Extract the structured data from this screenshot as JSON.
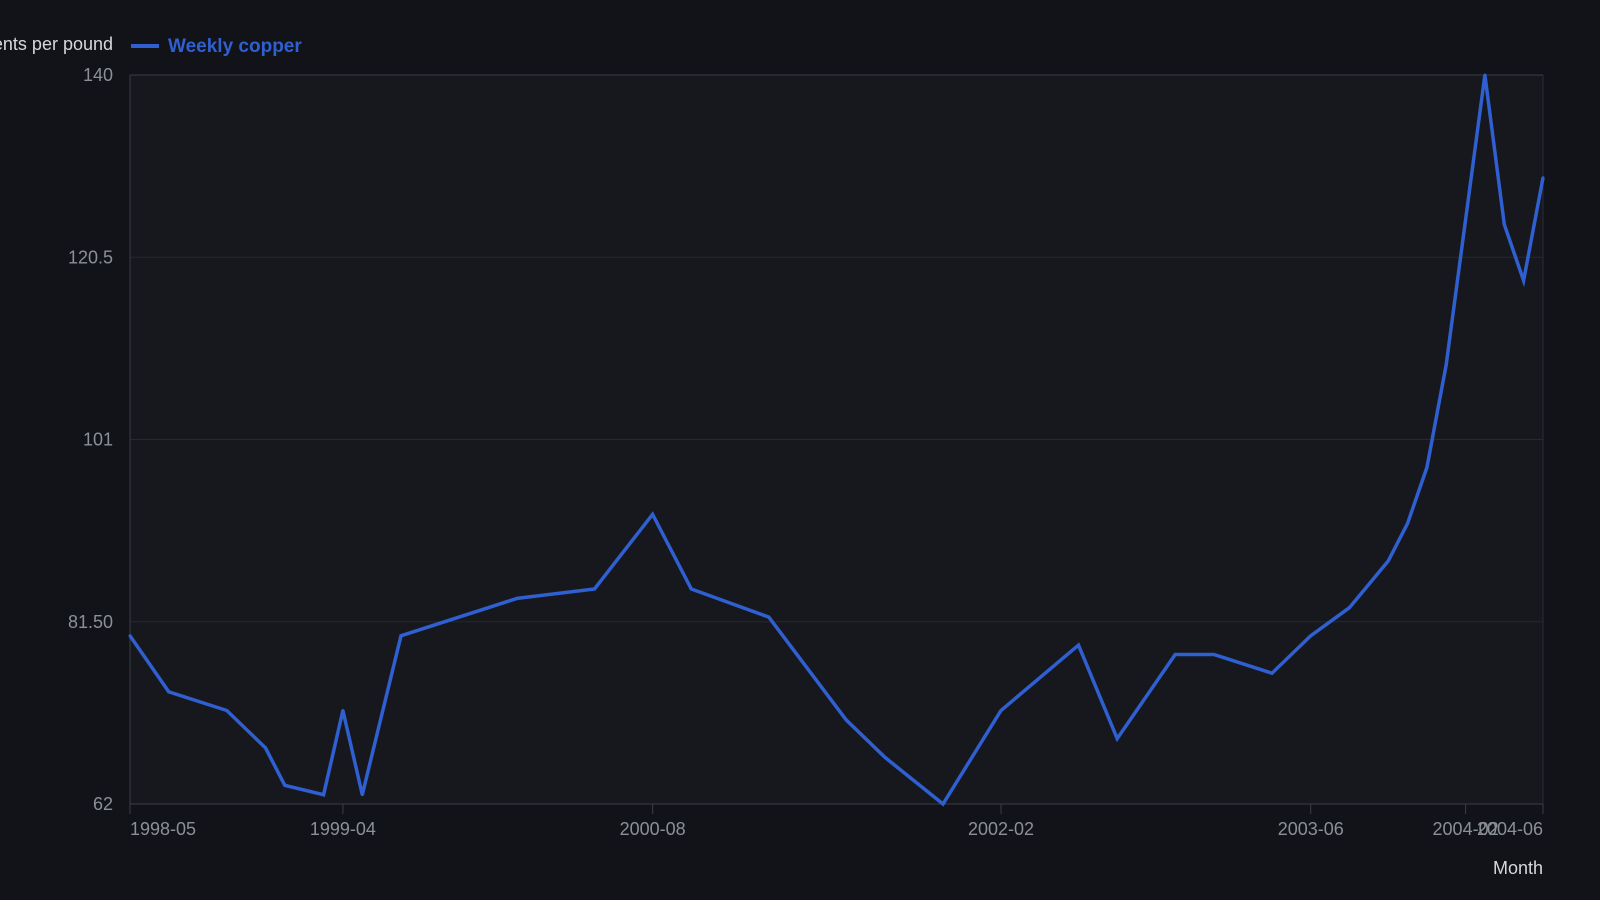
{
  "chart_data": {
    "type": "line",
    "ylabel": "Cents per pound",
    "xlabel": "Month",
    "legend_position": "top-left",
    "grid": "horizontal",
    "ylim": [
      62,
      140
    ],
    "y_ticks": [
      "62",
      "81.50",
      "101",
      "120.5",
      "140"
    ],
    "x_tick_labels": [
      "1998-05",
      "1999-04",
      "2000-08",
      "2002-02",
      "2003-06",
      "2004-02",
      "2004-06"
    ],
    "series": [
      {
        "name": "Weekly copper",
        "color": "#2f5fd0",
        "points": [
          {
            "x": "1998-05",
            "y": 80.0
          },
          {
            "x": "1998-07",
            "y": 74.0
          },
          {
            "x": "1998-10",
            "y": 72.0
          },
          {
            "x": "1998-12",
            "y": 68.0
          },
          {
            "x": "1999-01",
            "y": 64.0
          },
          {
            "x": "1999-03",
            "y": 63.0
          },
          {
            "x": "1999-04",
            "y": 72.0
          },
          {
            "x": "1999-05",
            "y": 63.0
          },
          {
            "x": "1999-07",
            "y": 80.0
          },
          {
            "x": "1999-10",
            "y": 82.0
          },
          {
            "x": "2000-01",
            "y": 84.0
          },
          {
            "x": "2000-05",
            "y": 85.0
          },
          {
            "x": "2000-08",
            "y": 93.0
          },
          {
            "x": "2000-10",
            "y": 85.0
          },
          {
            "x": "2001-02",
            "y": 82.0
          },
          {
            "x": "2001-06",
            "y": 71.0
          },
          {
            "x": "2001-08",
            "y": 67.0
          },
          {
            "x": "2001-11",
            "y": 62.0
          },
          {
            "x": "2002-02",
            "y": 72.0
          },
          {
            "x": "2002-06",
            "y": 79.0
          },
          {
            "x": "2002-08",
            "y": 69.0
          },
          {
            "x": "2002-11",
            "y": 78.0
          },
          {
            "x": "2003-01",
            "y": 78.0
          },
          {
            "x": "2003-04",
            "y": 76.0
          },
          {
            "x": "2003-06",
            "y": 80.0
          },
          {
            "x": "2003-08",
            "y": 83.0
          },
          {
            "x": "2003-10",
            "y": 88.0
          },
          {
            "x": "2003-11",
            "y": 92.0
          },
          {
            "x": "2003-12",
            "y": 98.0
          },
          {
            "x": "2004-01",
            "y": 109.0
          },
          {
            "x": "2004-03",
            "y": 140.0
          },
          {
            "x": "2004-04",
            "y": 124.0
          },
          {
            "x": "2004-05",
            "y": 118.0
          },
          {
            "x": "2004-06",
            "y": 129.0
          }
        ]
      }
    ]
  }
}
